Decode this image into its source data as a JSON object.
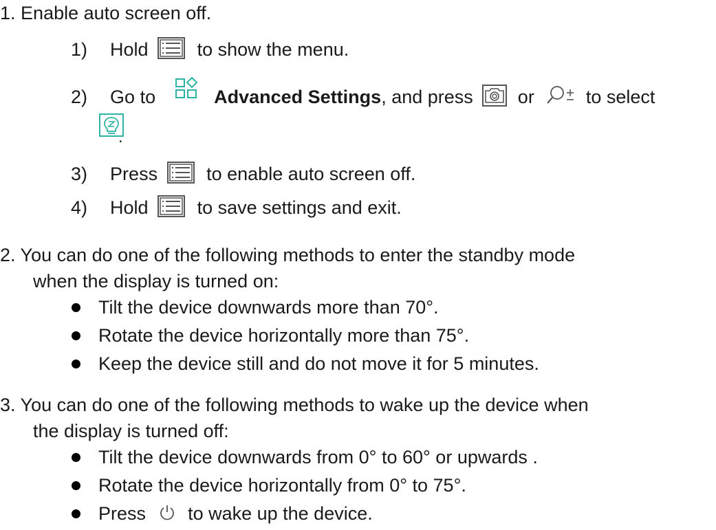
{
  "steps": [
    {
      "number": "1.",
      "text": "Enable auto screen off.",
      "substeps": [
        {
          "number": "1)",
          "before": "Hold",
          "icon": "menu-icon",
          "after": "to show the menu."
        },
        {
          "number": "2)",
          "before": "Go to",
          "icon": "advanced-settings-icon",
          "bold": "Advanced Settings",
          "middle": ", and press",
          "icon2": "camera-icon",
          "or": "or",
          "icon3": "zoom-icon",
          "after": "to select",
          "icon4": "auto-screen-off-icon",
          "tail": "."
        },
        {
          "number": "3)",
          "before": "Press",
          "icon": "menu-icon",
          "after": "to enable auto screen off."
        },
        {
          "number": "4)",
          "before": "Hold",
          "icon": "menu-icon",
          "after": "to save settings and exit."
        }
      ]
    },
    {
      "number": "2.",
      "line1": "You can do one of the following methods to enter the standby mode",
      "line2": "when the display is turned on:",
      "bullets": [
        "Tilt the device downwards more than 70°.",
        "Rotate the device horizontally more than 75°.",
        "Keep the device still and do not move it for 5 minutes."
      ]
    },
    {
      "number": "3.",
      "line1": "You can do one of the following methods to wake up the device when",
      "line2": "the display is turned off:",
      "bullets": [
        "Tilt the device downwards from 0° to 60° or upwards .",
        "Rotate the device horizontally from 0° to 75°."
      ],
      "last_bullet": {
        "before": "Press",
        "icon": "power-icon",
        "after": "to wake up the device."
      }
    }
  ],
  "colors": {
    "text": "#1a1a1a",
    "icon_stroke": "#555555",
    "accent": "#2bb3a3"
  }
}
